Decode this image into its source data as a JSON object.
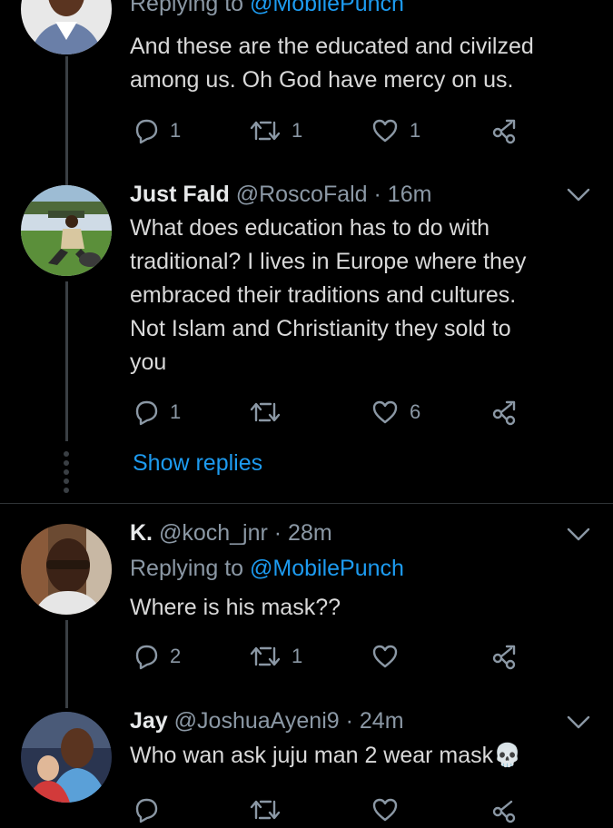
{
  "tweets": [
    {
      "reply_prefix": "Replying to ",
      "reply_mention": "@MobilePunch",
      "text_lines": [
        "And these are the educated and civilzed",
        "among us. Oh God have mercy on us."
      ],
      "reply_count": "1",
      "retweet_count": "1",
      "like_count": "1"
    },
    {
      "name": "Just Fald",
      "handle": "@RoscoFald",
      "time": "· 16m",
      "text_lines": [
        "What does education has to do with",
        "traditional? I lives in Europe where they",
        "embraced their traditions and cultures.",
        "Not Islam and Christianity they sold to",
        "you"
      ],
      "reply_count": "1",
      "retweet_count": "",
      "like_count": "6",
      "show_replies": "Show replies"
    },
    {
      "name": "K.",
      "handle": "@koch_jnr",
      "time": "· 28m",
      "reply_prefix": "Replying to ",
      "reply_mention": "@MobilePunch",
      "text_lines": [
        "Where is his mask??"
      ],
      "reply_count": "2",
      "retweet_count": "1",
      "like_count": ""
    },
    {
      "name": "Jay",
      "handle": "@JoshuaAyeni9",
      "time": "· 24m",
      "text_lines": [
        "Who wan ask juju man 2 wear mask"
      ],
      "emoji": "💀"
    }
  ],
  "icons": {
    "reply": "reply-icon",
    "retweet": "retweet-icon",
    "like": "heart-icon",
    "share": "share-icon",
    "more": "chevron-down-icon"
  },
  "colors": {
    "background": "#000000",
    "text": "#d9d9d9",
    "muted": "#8b98a5",
    "accent": "#1d9bf0"
  }
}
